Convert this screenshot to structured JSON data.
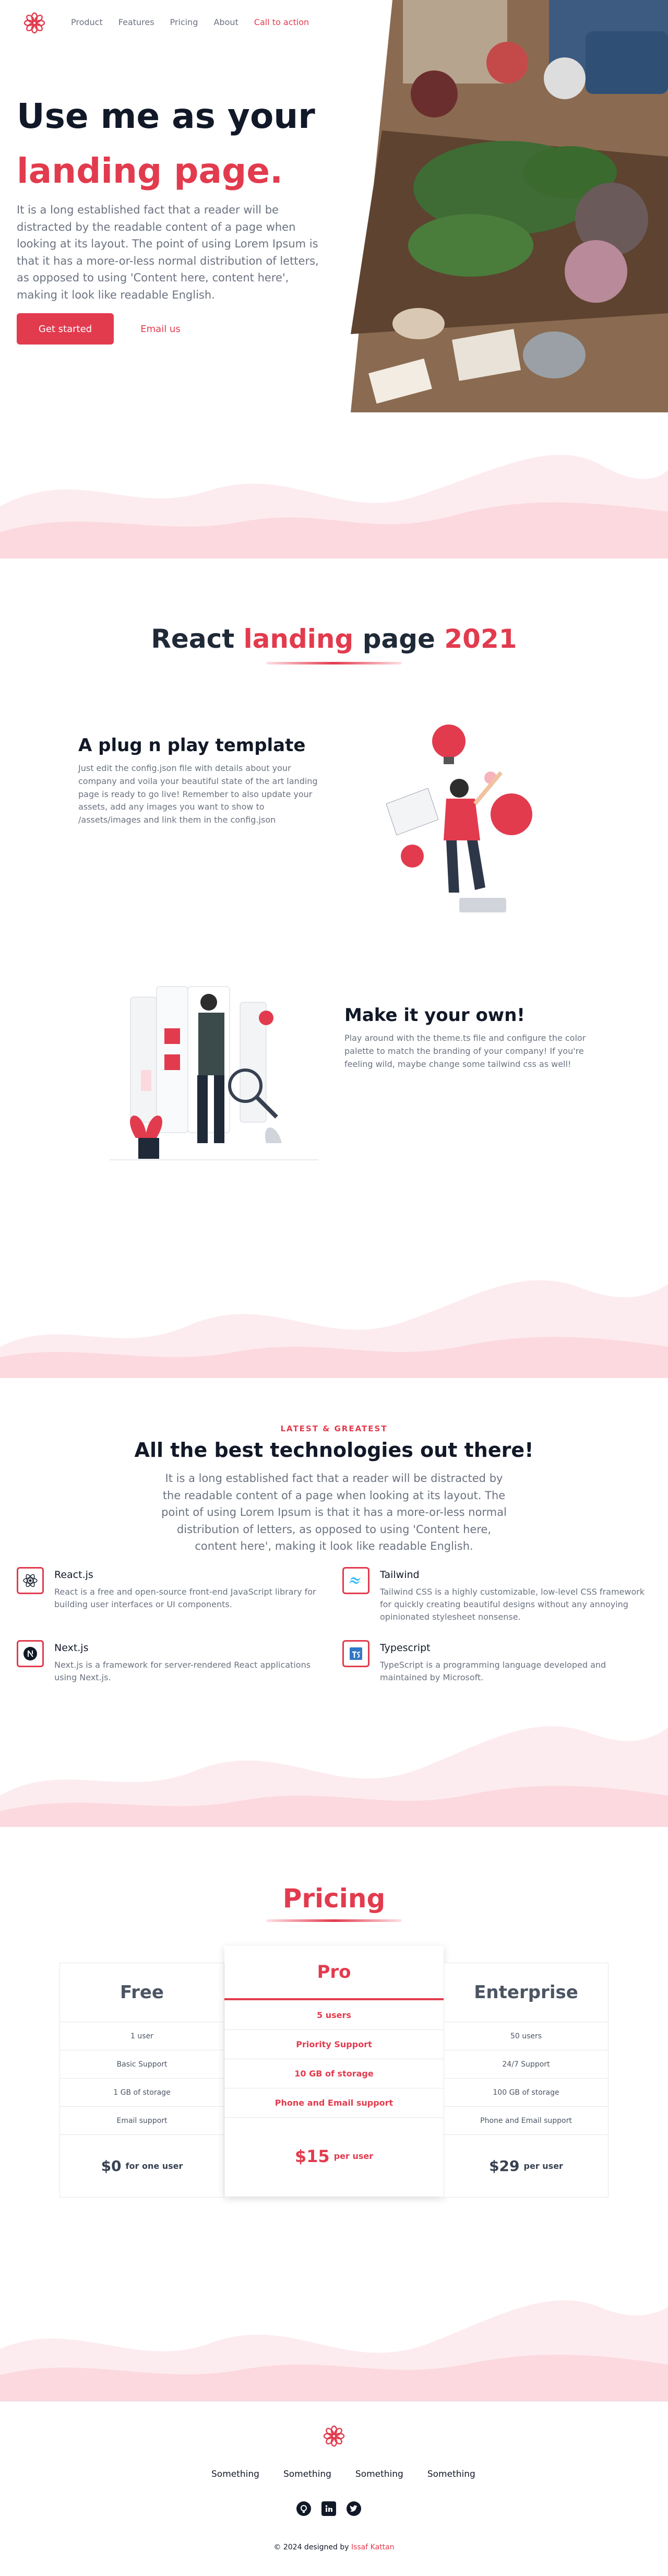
{
  "header": {
    "nav": [
      "Product",
      "Features",
      "Pricing",
      "About"
    ],
    "cta": "Call to action"
  },
  "hero": {
    "title_line1": "Use me as your",
    "title_line2": "landing page.",
    "text": "It is a long established fact that a reader will be distracted by the readable content of a page when looking at its layout. The point of using Lorem Ipsum is that it has a more-or-less normal distribution of letters, as opposed to using 'Content here, content here', making it look like readable English.",
    "primary_button": "Get started",
    "secondary_button": "Email us"
  },
  "features": {
    "heading_part1": "React ",
    "heading_part2": "landing",
    "heading_part3": " page ",
    "heading_part4": "2021",
    "block1": {
      "title": "A plug n play template",
      "text": "Just edit the config.json file with details about your company and voila your beautiful state of the art landing page is ready to go live! Remember to also update your assets, add any images you want to show to /assets/images and link them in the config.json"
    },
    "block2": {
      "title": "Make it your own!",
      "text": "Play around with the theme.ts file and configure the color palette to match the branding of your company! If you're feeling wild, maybe change some tailwind css as well!"
    }
  },
  "tech": {
    "eyebrow": "LATEST & GREATEST",
    "heading": "All the best technologies out there!",
    "text": "It is a long established fact that a reader will be distracted by the readable content of a page when looking at its layout. The point of using Lorem Ipsum is that it has a more-or-less normal distribution of letters, as opposed to using 'Content here, content here', making it look like readable English.",
    "items": [
      {
        "name": "React.js",
        "desc": "React is a free and open-source front-end JavaScript library for building user interfaces or UI components.",
        "icon": "react-icon"
      },
      {
        "name": "Tailwind",
        "desc": "Tailwind CSS is a highly customizable, low-level CSS framework for quickly creating beautiful designs without any annoying opinionated stylesheet nonsense.",
        "icon": "tailwind-icon"
      },
      {
        "name": "Next.js",
        "desc": "Next.js is a framework for server-rendered React applications using Next.js.",
        "icon": "nextjs-icon"
      },
      {
        "name": "Typescript",
        "desc": "TypeScript is a programming language developed and maintained by Microsoft.",
        "icon": "typescript-icon"
      }
    ]
  },
  "pricing": {
    "heading": "Pricing",
    "plans": [
      {
        "name": "Free",
        "features": [
          "1 user",
          "Basic Support",
          "1 GB of storage",
          "Email support"
        ],
        "price": "$0",
        "period": "for one user"
      },
      {
        "name": "Pro",
        "features": [
          "5 users",
          "Priority Support",
          "10 GB of storage",
          "Phone and Email support"
        ],
        "price": "$15",
        "period": "per user"
      },
      {
        "name": "Enterprise",
        "features": [
          "50 users",
          "24/7 Support",
          "100 GB of storage",
          "Phone and Email support"
        ],
        "price": "$29",
        "period": "per user"
      }
    ]
  },
  "footer": {
    "links": [
      "Something",
      "Something",
      "Something",
      "Something"
    ],
    "socials": [
      "github-icon",
      "linkedin-icon",
      "twitter-icon"
    ],
    "copyright_prefix": "© 2024 designed by ",
    "author": "Issaf Kattan"
  },
  "colors": {
    "accent": "#e23b4e",
    "accent_light": "#fde2e6",
    "text_dark": "#111827",
    "text_muted": "#6b7280"
  }
}
